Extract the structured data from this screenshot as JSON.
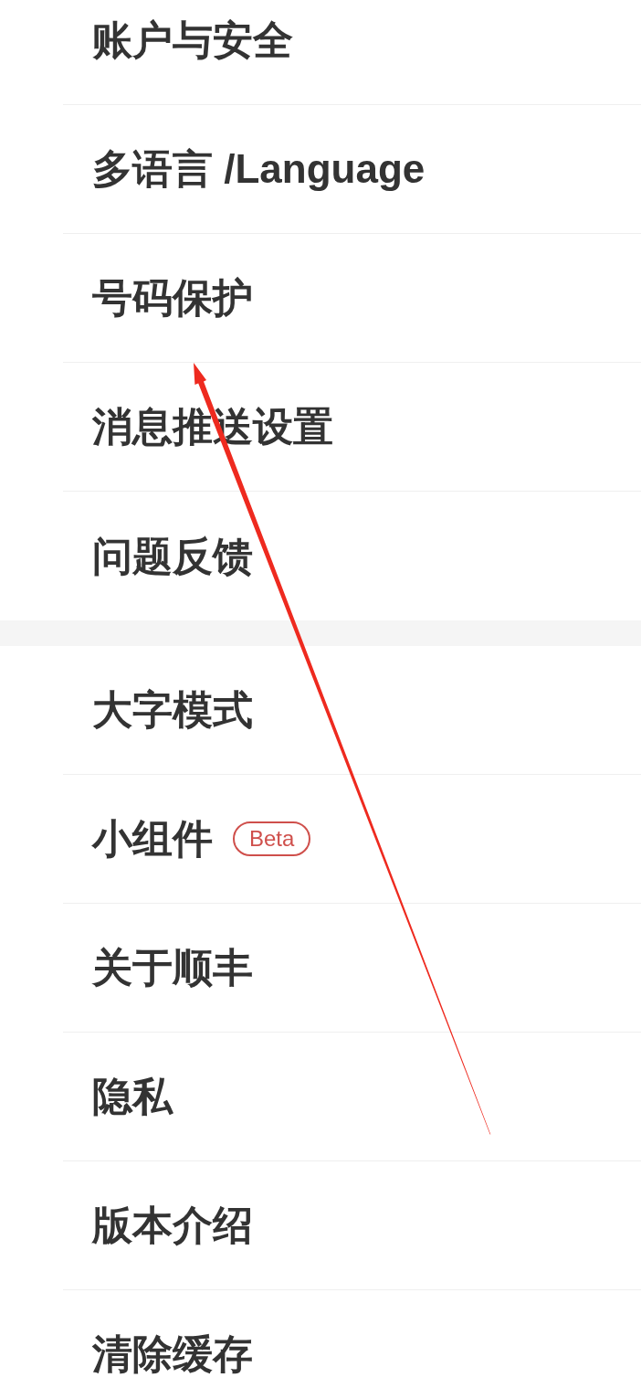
{
  "sections": [
    {
      "items": [
        {
          "label": "账户与安全"
        },
        {
          "label": "多语言 /Language"
        },
        {
          "label": "号码保护"
        },
        {
          "label": "消息推送设置"
        },
        {
          "label": "问题反馈"
        }
      ]
    },
    {
      "items": [
        {
          "label": "大字模式"
        },
        {
          "label": "小组件",
          "badge": "Beta"
        },
        {
          "label": "关于顺丰"
        },
        {
          "label": "隐私"
        },
        {
          "label": "版本介绍"
        },
        {
          "label": "清除缓存"
        }
      ]
    }
  ]
}
